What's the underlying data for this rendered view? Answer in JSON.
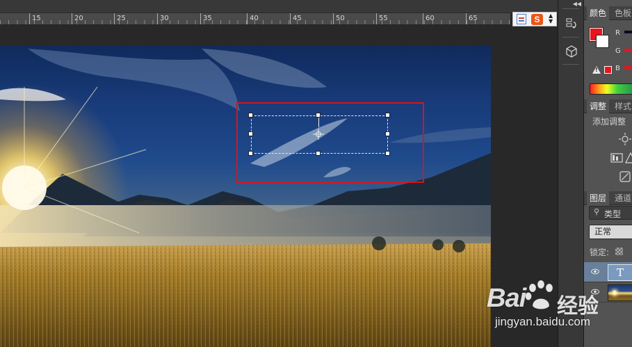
{
  "ruler": {
    "labels": [
      "15",
      "20",
      "25",
      "30",
      "35",
      "40",
      "45",
      "50",
      "55",
      "60",
      "65"
    ]
  },
  "color_panel": {
    "tabs": [
      "颜色",
      "色板"
    ],
    "channels": [
      "R",
      "G",
      "B"
    ],
    "foreground_color": "#e8141e",
    "background_color": "#ffffff"
  },
  "adjustments_panel": {
    "tabs": [
      "调整",
      "样式"
    ],
    "heading": "添加调整"
  },
  "layers_panel": {
    "tabs": [
      "图层",
      "通道"
    ],
    "filter_label": "类型",
    "blend_mode": "正常",
    "lock_label": "锁定:",
    "layers": [
      {
        "kind": "text",
        "thumb_glyph": "T",
        "selected": true
      },
      {
        "kind": "image",
        "selected": false
      }
    ]
  },
  "icons": {
    "history": "history-icon",
    "3d": "3d-cube-icon",
    "visibility": "eye-icon",
    "search": "search-icon"
  },
  "watermark": {
    "brand": "Bai",
    "product": "经验",
    "url": "jingyan.baidu.com"
  },
  "accent": {
    "selection_outline": "#d8141b"
  }
}
